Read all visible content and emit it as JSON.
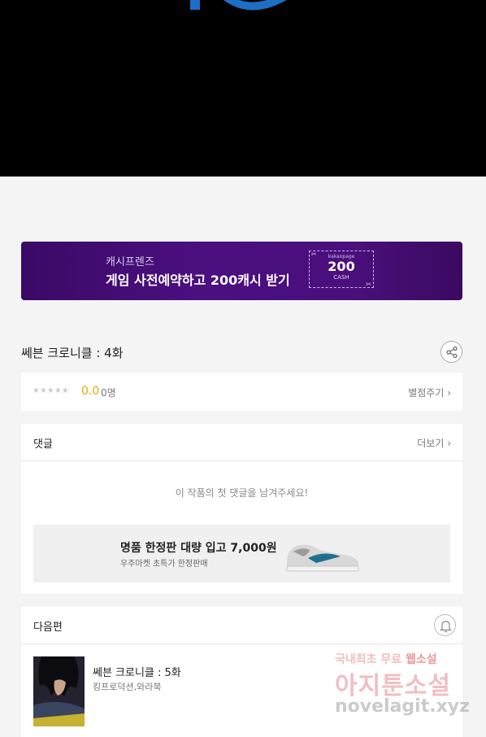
{
  "banner": {
    "subtitle": "캐시프렌즈",
    "title": "게임 사전예약하고 200캐시 받기",
    "coupon_brand": "kakaopage",
    "coupon_amount": "200",
    "coupon_unit": "CASH"
  },
  "episode": {
    "title": "쎄븐 크로니클 : 4화"
  },
  "rating": {
    "stars": "★★★★★",
    "score": "0.0",
    "count": "0명",
    "rate_label": "별점주기 ›"
  },
  "comments": {
    "title": "댓글",
    "more_label": "더보기 ›",
    "empty_message": "이 작품의 첫 댓글을 남겨주세요!",
    "ad": {
      "title": "명품 한정판 대량 입고 7,000원",
      "subtitle": "우주마켓 초특가 한정판매"
    }
  },
  "next": {
    "section_title": "다음편",
    "episode_title": "쎄븐 크로니클 : 5화",
    "author": "킹프로덕션,와라북"
  },
  "watermark": {
    "line1_prefix": "국내최초 무료",
    "line1_highlight": "웹소설",
    "line2": "아지툰소설",
    "line3": "novelagit.xyz"
  }
}
